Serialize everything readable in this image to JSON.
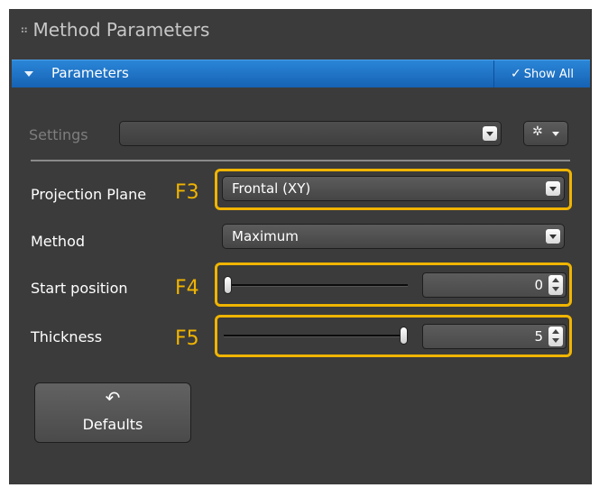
{
  "panel": {
    "title": "Method Parameters",
    "grip_icon": "⠶"
  },
  "section": {
    "label": "Parameters",
    "show_all_label": "Show All"
  },
  "settings": {
    "label": "Settings",
    "value": ""
  },
  "projection_plane": {
    "label": "Projection Plane",
    "value": "Frontal (XY)",
    "hotkey": "F3"
  },
  "method": {
    "label": "Method",
    "value": "Maximum"
  },
  "start_position": {
    "label": "Start position",
    "value": "0",
    "hotkey": "F4",
    "slider_fraction": 0.0
  },
  "thickness": {
    "label": "Thickness",
    "value": "5",
    "hotkey": "F5",
    "slider_fraction": 1.0
  },
  "defaults_button": {
    "label": "Defaults"
  },
  "colors": {
    "panel_bg": "#3b3b3b",
    "header_blue": "#1e74c8",
    "highlight": "#f0b400"
  }
}
